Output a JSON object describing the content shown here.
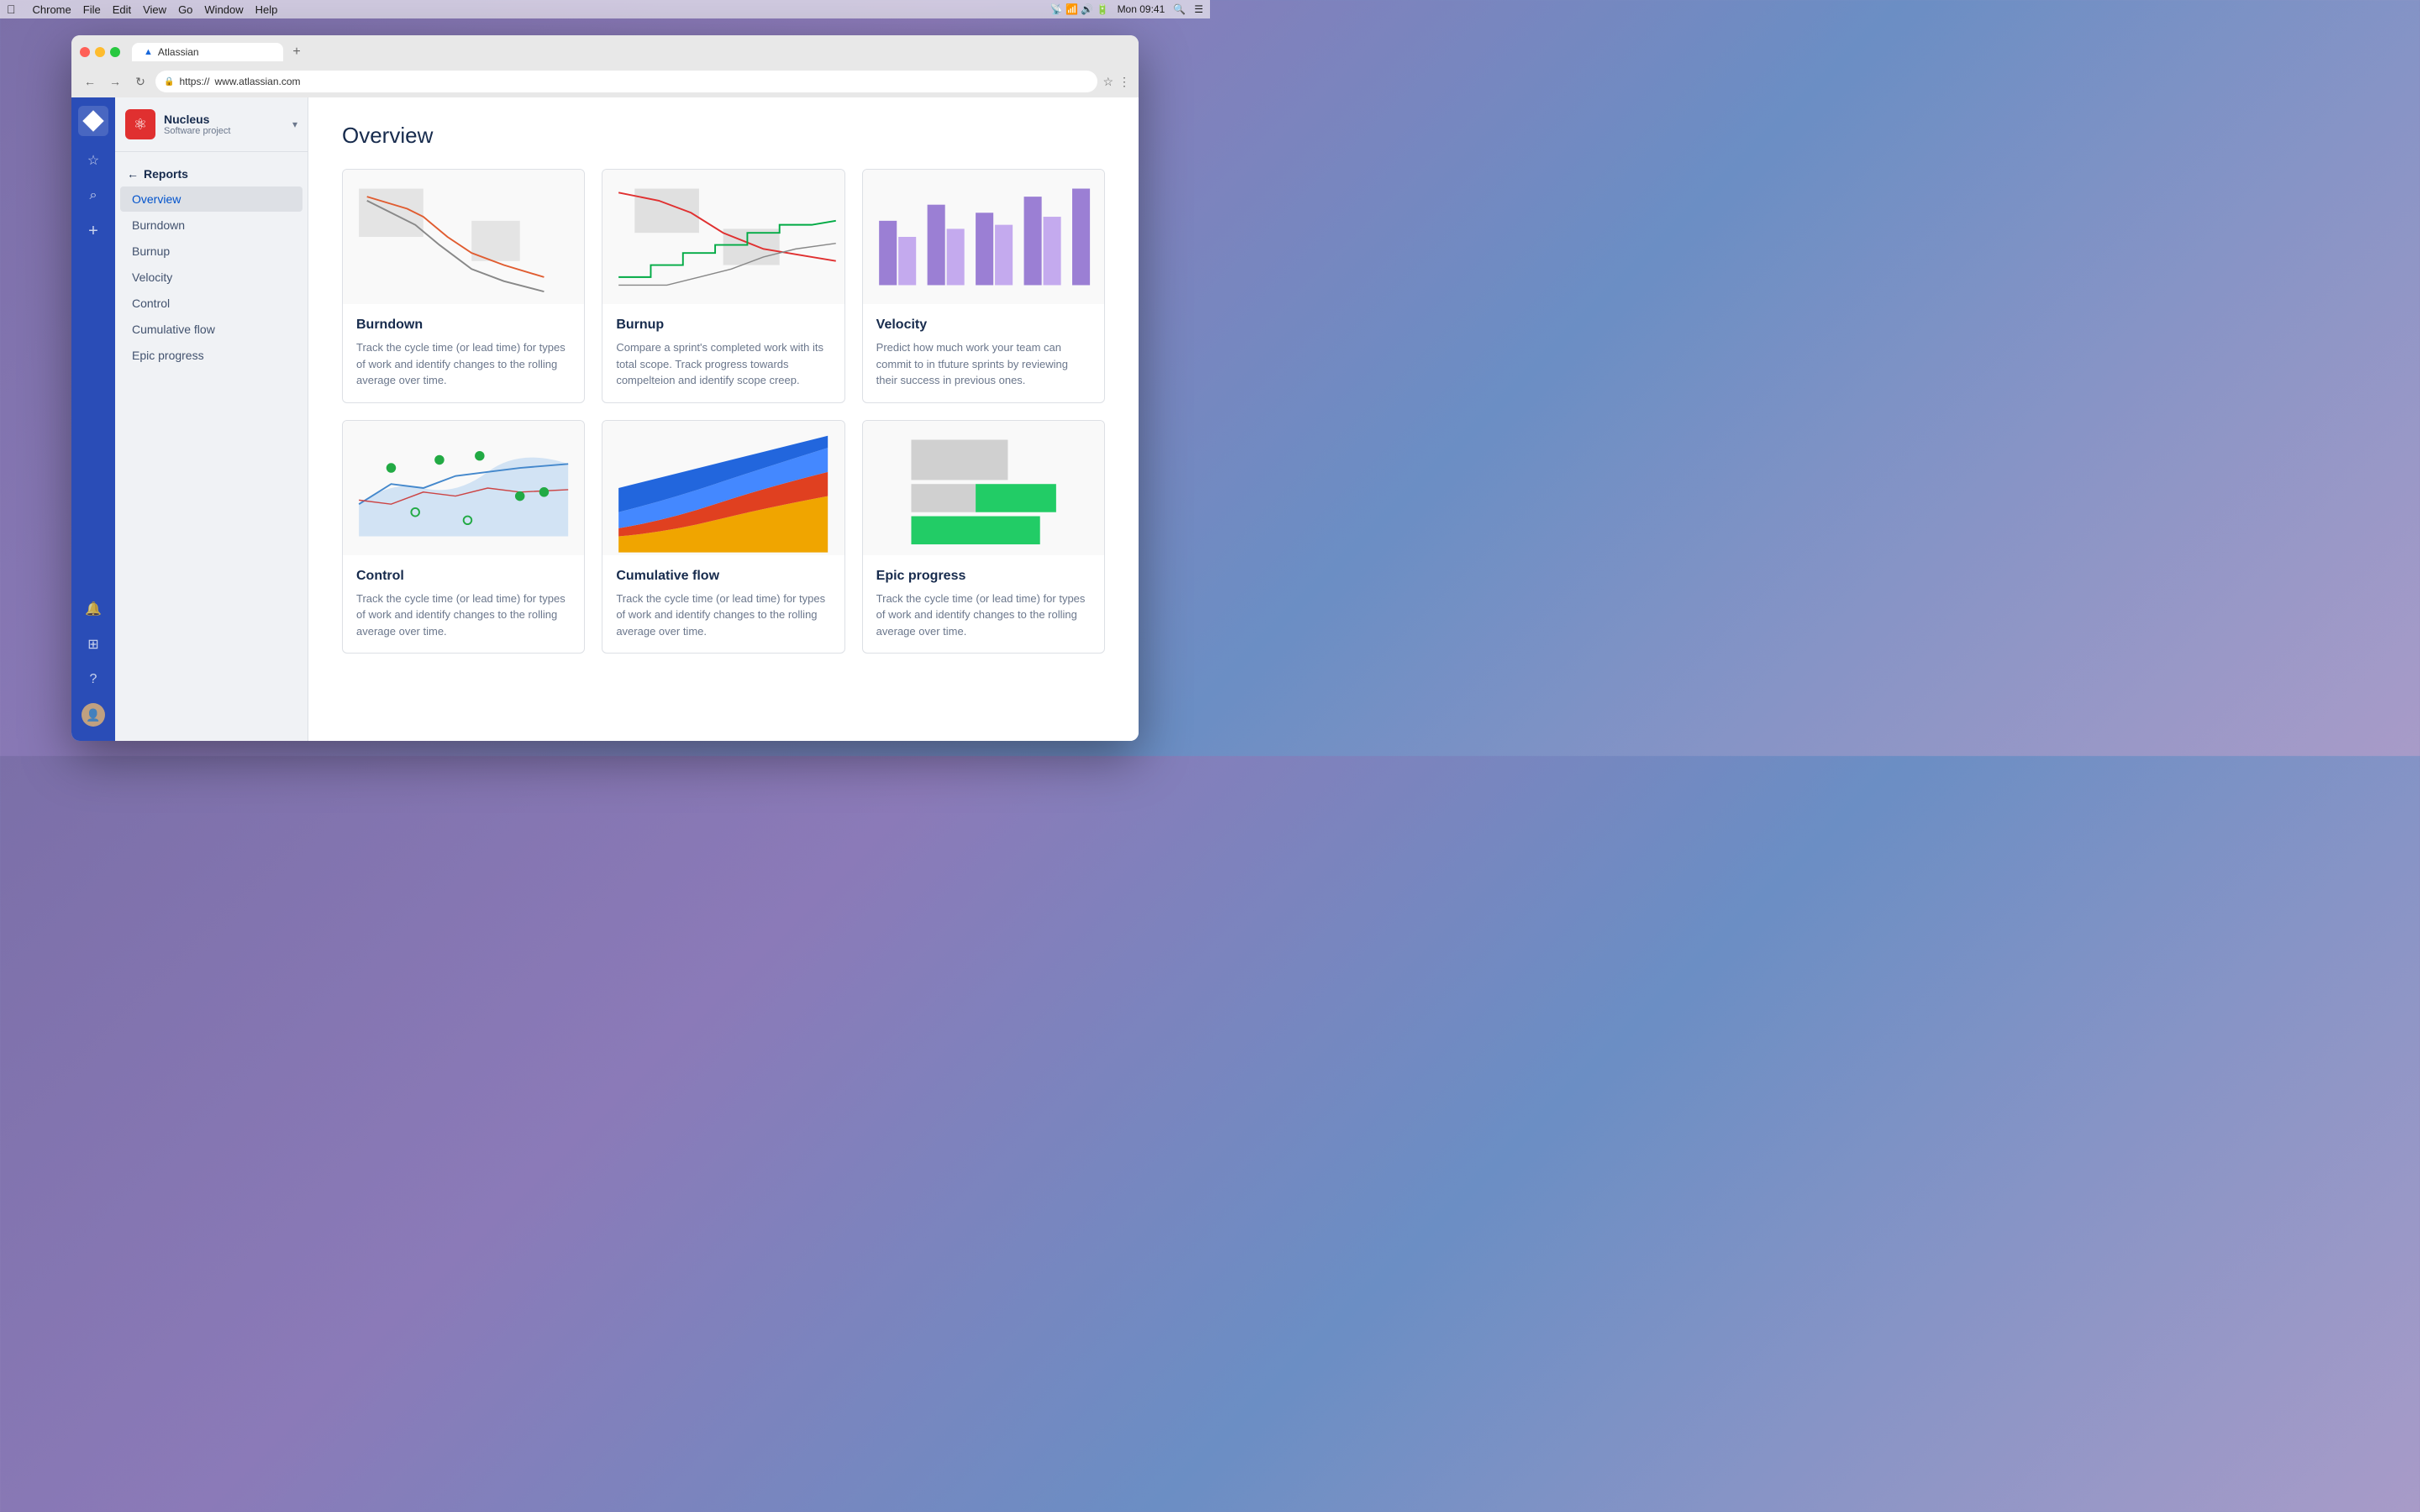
{
  "menubar": {
    "apple": "&#63743;",
    "items": [
      "Chrome",
      "File",
      "Edit",
      "View",
      "Go",
      "Window",
      "Help"
    ],
    "time": "Mon 09:41"
  },
  "browser": {
    "tab_label": "Atlassian",
    "tab_add": "+",
    "url_protocol": "https://",
    "url_host": "www.atlassian.com",
    "nav_back": "←",
    "nav_forward": "→",
    "nav_refresh": "↻"
  },
  "sidebar_icons": {
    "diamond": "◆",
    "star": "☆",
    "search": "⌕",
    "plus": "+",
    "bell": "🔔",
    "grid": "⊞",
    "help": "?"
  },
  "project": {
    "name": "Nucleus",
    "type": "Software project",
    "logo_icon": "⚛"
  },
  "nav": {
    "back_label": "Reports",
    "back_arrow": "←",
    "items": [
      {
        "id": "overview",
        "label": "Overview",
        "active": true
      },
      {
        "id": "burndown",
        "label": "Burndown",
        "active": false
      },
      {
        "id": "burnup",
        "label": "Burnup",
        "active": false
      },
      {
        "id": "velocity",
        "label": "Velocity",
        "active": false
      },
      {
        "id": "control",
        "label": "Control",
        "active": false
      },
      {
        "id": "cumulative-flow",
        "label": "Cumulative flow",
        "active": false
      },
      {
        "id": "epic-progress",
        "label": "Epic progress",
        "active": false
      }
    ]
  },
  "main": {
    "title": "Overview",
    "cards": [
      {
        "id": "burndown",
        "title": "Burndown",
        "desc": "Track the cycle time (or lead time) for types of work and identify changes to the rolling average over time.",
        "chart_type": "burndown"
      },
      {
        "id": "burnup",
        "title": "Burnup",
        "desc": "Compare a sprint's completed work with its total scope. Track progress towards compelteion and identify scope creep.",
        "chart_type": "burnup"
      },
      {
        "id": "velocity",
        "title": "Velocity",
        "desc": "Predict how much work your team can commit to in tfuture sprints by reviewing their success in previous ones.",
        "chart_type": "velocity"
      },
      {
        "id": "control",
        "title": "Control",
        "desc": "Track the cycle time (or lead time) for types of work and identify changes to the rolling average over time.",
        "chart_type": "control"
      },
      {
        "id": "cumulative-flow",
        "title": "Cumulative flow",
        "desc": "Track the cycle time (or lead time) for types of work and identify changes to the rolling average over time.",
        "chart_type": "cumulative"
      },
      {
        "id": "epic-progress",
        "title": "Epic progress",
        "desc": "Track the cycle time (or lead time) for types of work and identify changes to the rolling average over time.",
        "chart_type": "epic"
      }
    ]
  }
}
